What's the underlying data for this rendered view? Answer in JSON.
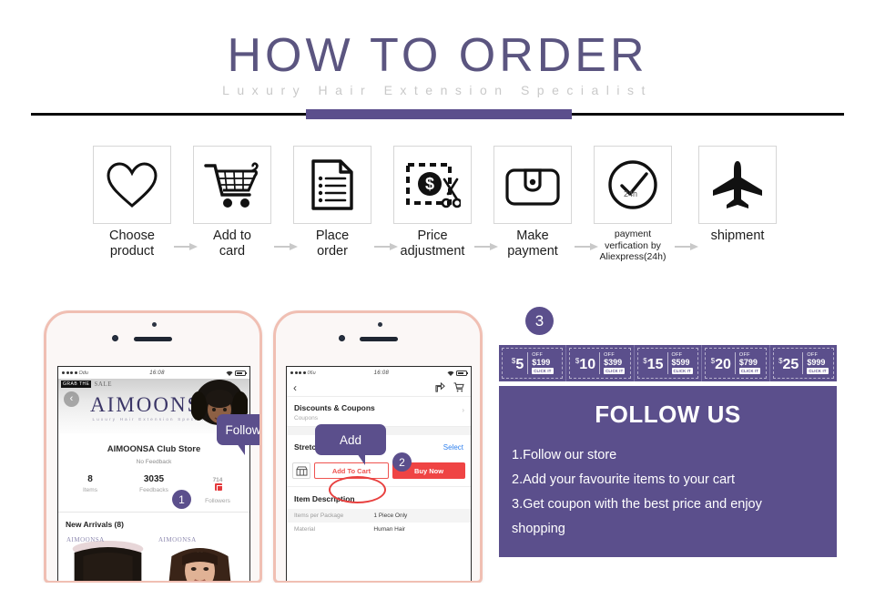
{
  "header": {
    "title": "HOW TO ORDER",
    "subtitle": "Luxury Hair Extension Specialist",
    "accent_color": "#5b4f8c",
    "title_color": "#5b5580",
    "subtitle_color": "#c9c9c9"
  },
  "steps": [
    {
      "icon": "heart-icon",
      "label_line1": "Choose",
      "label_line2": "product"
    },
    {
      "icon": "shopping-cart-icon",
      "label_line1": "Add to",
      "label_line2": "card"
    },
    {
      "icon": "document-list-icon",
      "label_line1": "Place",
      "label_line2": "order"
    },
    {
      "icon": "price-scissors-icon",
      "label_line1": "Price",
      "label_line2": "adjustment"
    },
    {
      "icon": "wallet-icon",
      "label_line1": "Make",
      "label_line2": "payment"
    },
    {
      "icon": "clock-check-24h-icon",
      "label_line1": "payment",
      "label_line2": "verfication by",
      "label_line3": "Aliexpress(24h)",
      "small": true
    },
    {
      "icon": "airplane-icon",
      "label_line1": "shipment",
      "label_line2": ""
    }
  ],
  "phone1": {
    "status": {
      "carrier": "Odu",
      "time": "16:08"
    },
    "sale_tag_black": "GRAB THE",
    "sale_tag_script": "SALE",
    "back_icon": "back-chevron-icon",
    "logo": "AIMOONSA",
    "logo_sub": "Luxury Hair Extension Specialist",
    "store_name": "AIMOONSA Club Store",
    "feedback": "No Feedback",
    "stats": [
      {
        "value": "8",
        "label": "Items"
      },
      {
        "value": "3035",
        "label": "Feedbacks"
      },
      {
        "value": "714",
        "label": "Followers",
        "badge": true
      }
    ],
    "new_arrivals": "New Arrivals (8)",
    "watermark": "AIMOONSA",
    "tooltip": "Follow us",
    "badge": "1"
  },
  "phone2": {
    "status": {
      "carrier": "06u",
      "time": "16:08"
    },
    "back_icon": "back-chevron-icon",
    "nav_icons": [
      "share-icon",
      "cart-icon"
    ],
    "discounts_title": "Discounts & Coupons",
    "discounts_sub": "Coupons",
    "length_label": "Stretched Length",
    "select_label": "Select",
    "shop_icon": "store-icon",
    "add_to_cart": "Add To Cart",
    "buy_now": "Buy Now",
    "item_description": "Item Description",
    "description_rows": [
      {
        "key": "Items per Package",
        "value": "1 Piece Only"
      },
      {
        "key": "Material",
        "value": "Human Hair"
      }
    ],
    "tooltip": "Add",
    "badge": "2"
  },
  "right": {
    "badge": "3",
    "coupons": [
      {
        "amount": "5",
        "currency": "$",
        "off": "OFF",
        "min": "$199",
        "cta": "CLICK IT"
      },
      {
        "amount": "10",
        "currency": "$",
        "off": "OFF",
        "min": "$399",
        "cta": "CLICK IT"
      },
      {
        "amount": "15",
        "currency": "$",
        "off": "OFF",
        "min": "$599",
        "cta": "CLICK IT"
      },
      {
        "amount": "20",
        "currency": "$",
        "off": "OFF",
        "min": "$799",
        "cta": "CLICK IT"
      },
      {
        "amount": "25",
        "currency": "$",
        "off": "OFF",
        "min": "$999",
        "cta": "CLICK IT"
      }
    ],
    "follow_title": "FOLLOW US",
    "follow_items": [
      "1.Follow our store",
      "2.Add your favourite items to your cart",
      "3.Get coupon with the best price and enjoy",
      "shopping"
    ]
  }
}
